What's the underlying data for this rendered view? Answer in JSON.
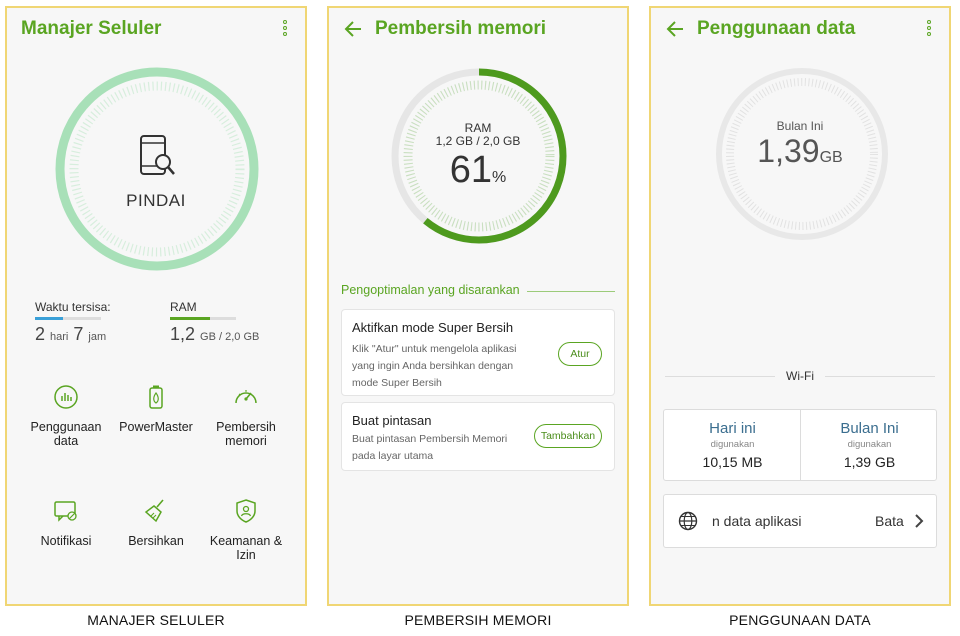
{
  "screens": [
    {
      "title": "Manajer Seluler",
      "caption": "MANAJER SELULER",
      "scan_label": "PINDAI",
      "stats": {
        "time_label": "Waktu tersisa:",
        "time_days": "2",
        "time_days_unit": "hari",
        "time_hours": "7",
        "time_hours_unit": "jam",
        "ram_label": "RAM",
        "ram_value": "1,2",
        "ram_unit": "GB / 2,0 GB",
        "time_bar_fraction": 0.42,
        "ram_bar_fraction": 0.61
      },
      "grid": [
        {
          "label": "Penggunaan data",
          "icon": "data-usage-icon"
        },
        {
          "label": "PowerMaster",
          "icon": "battery-icon"
        },
        {
          "label": "Pembersih memori",
          "icon": "speedometer-icon"
        },
        {
          "label": "Notifikasi",
          "icon": "notification-icon"
        },
        {
          "label": "Bersihkan",
          "icon": "broom-icon"
        },
        {
          "label": "Keamanan & Izin",
          "icon": "shield-icon"
        }
      ]
    },
    {
      "title": "Pembersih memori",
      "caption": "PEMBERSIH MEMORI",
      "ram_label": "RAM",
      "ram_detail": "1,2 GB / 2,0 GB",
      "ram_percent": "61",
      "ram_percent_sign": "%",
      "ram_fraction": 0.61,
      "section_title": "Pengoptimalan yang disarankan",
      "cards": [
        {
          "title": "Aktifkan mode Super Bersih",
          "desc": "Klik \"Atur\" untuk mengelola aplikasi yang ingin Anda bersihkan dengan mode Super Bersih",
          "button": "Atur"
        },
        {
          "title": "Buat pintasan",
          "desc": "Buat pintasan Pembersih Memori pada layar utama",
          "button": "Tambahkan"
        }
      ]
    },
    {
      "title": "Penggunaan data",
      "caption": "PENGGUNAAN DATA",
      "ring_label": "Bulan Ini",
      "ring_value": "1,39",
      "ring_unit": "GB",
      "wifi_label": "Wi-Fi",
      "today_label": "Hari ini",
      "today_sub": "digunakan",
      "today_value": "10,15 MB",
      "month_label": "Bulan Ini",
      "month_sub": "digunakan",
      "month_value": "1,39 GB",
      "app_row_text": "n data aplikasi",
      "app_row_right": "Bata"
    }
  ],
  "colors": {
    "accent": "#5aa522",
    "ring_light": "#a8e0b8",
    "frame": "#f0d674"
  }
}
